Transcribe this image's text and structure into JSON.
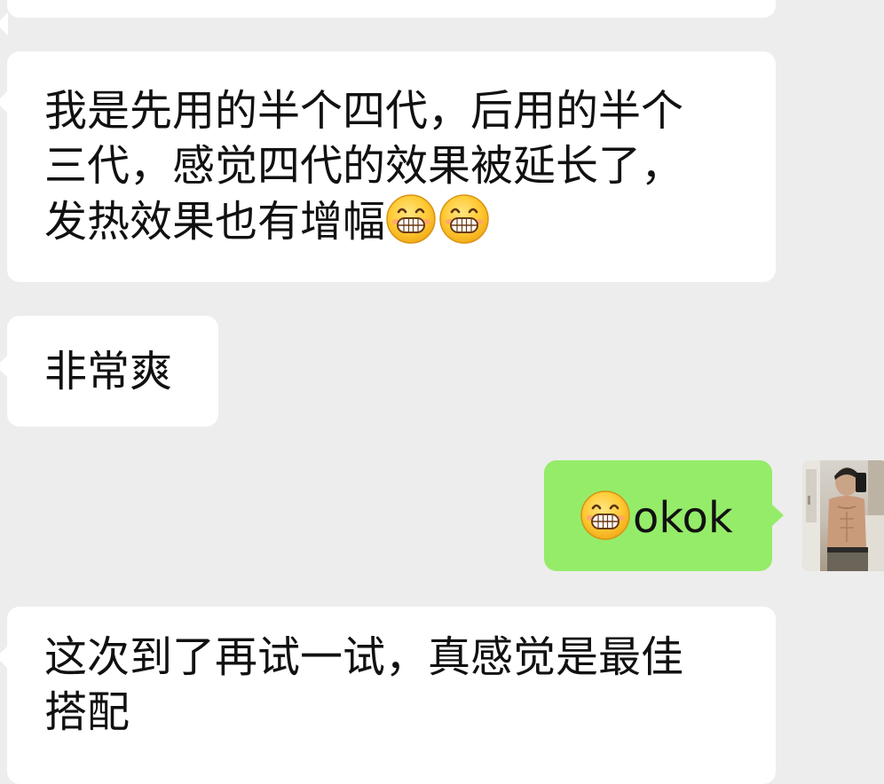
{
  "chat": {
    "messages": [
      {
        "side": "incoming",
        "lines": [
          "我是先用的半个四代，后用的半个",
          "三代，感觉四代的效果被延长了，",
          "发热效果也有增幅"
        ],
        "trailing_emoji": [
          "grin-emoji",
          "grin-emoji"
        ]
      },
      {
        "side": "incoming",
        "lines": [
          "非常爽"
        ]
      },
      {
        "side": "outgoing",
        "leading_emoji": [
          "grin-emoji"
        ],
        "text": "okok"
      },
      {
        "side": "incoming",
        "lines": [
          "这次到了再试一试，真感觉是最佳",
          "搭配"
        ]
      }
    ]
  },
  "colors": {
    "background": "#ededed",
    "incoming_bubble": "#ffffff",
    "outgoing_bubble": "#95ec69",
    "text": "#111111"
  }
}
